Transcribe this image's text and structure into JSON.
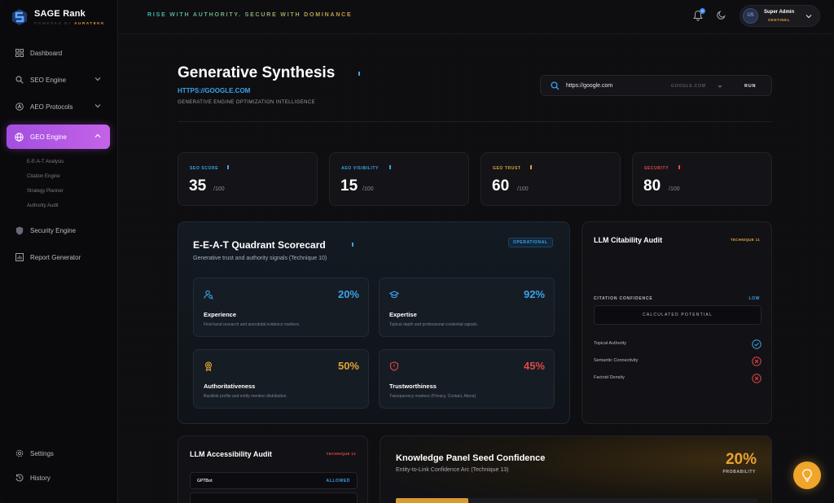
{
  "brand": {
    "name": "SAGE Rank",
    "powered_by": "POWERED BY",
    "vendor": "AURATEKK"
  },
  "sidebar": {
    "items": [
      {
        "label": "Dashboard",
        "icon": "grid-icon"
      },
      {
        "label": "SEO Engine",
        "icon": "search-icon"
      },
      {
        "label": "AEO Protocols",
        "icon": "aeo-icon"
      },
      {
        "label": "GEO Engine",
        "icon": "globe-icon",
        "active": true
      }
    ],
    "geo_subitems": [
      "E-E-A-T Analysis",
      "Citation Engine",
      "Strategy Planner",
      "Authority Audit"
    ],
    "security": "Security Engine",
    "report": "Report Generator",
    "settings": "Settings",
    "history": "History"
  },
  "topbar": {
    "tagline": "RISE WITH AUTHORITY. SECURE WITH DOMINANCE",
    "notification_count": "0",
    "user_initials": "US",
    "user_name": "Super Admin",
    "user_role": "SENTINEL"
  },
  "header": {
    "title": "Generative Synthesis",
    "url": "HTTPS://GOOGLE.COM",
    "subtitle": "GENERATIVE ENGINE OPTIMIZATION INTELLIGENCE"
  },
  "search": {
    "value": "https://google.com",
    "engine": "GOOGLE.COM",
    "run_label": "RUN"
  },
  "stats": [
    {
      "label": "SEO SCORE",
      "value": "35",
      "max": "/100",
      "color": "#3aa3e8"
    },
    {
      "label": "AEO VISIBILITY",
      "value": "15",
      "max": "/100",
      "color": "#3aa3e8"
    },
    {
      "label": "GEO TRUST",
      "value": "60",
      "max": "/100",
      "color": "#e0a435"
    },
    {
      "label": "SECURITY",
      "value": "80",
      "max": "/100",
      "color": "#e04848"
    }
  ],
  "eeat": {
    "title": "E-E-A-T Quadrant Scorecard",
    "description": "Generative trust and authority signals (Technique 10)",
    "status": "OPERATIONAL",
    "quadrants": [
      {
        "title": "Experience",
        "value": "20%",
        "desc": "First-hand research and anecdotal evidence markers.",
        "color": "#3aa3e8",
        "icon": "user-search-icon"
      },
      {
        "title": "Expertise",
        "value": "92%",
        "desc": "Topical depth and professional credential signals.",
        "color": "#3aa3e8",
        "icon": "graduation-cap-icon"
      },
      {
        "title": "Authoritativeness",
        "value": "50%",
        "desc": "Backlink profile and entity mention distribution.",
        "color": "#e0a435",
        "icon": "award-icon"
      },
      {
        "title": "Trustworthiness",
        "value": "45%",
        "desc": "Transparency markers (Privacy, Contact, About).",
        "color": "#e04848",
        "icon": "shield-alert-icon"
      }
    ]
  },
  "citability": {
    "title": "LLM Citability Audit",
    "technique": "TECHNIQUE 11",
    "confidence_label": "CITATION CONFIDENCE",
    "confidence_value": "LOW",
    "calculated": "CALCULATED POTENTIAL",
    "criteria": [
      {
        "label": "Topical Authority",
        "status": "pass"
      },
      {
        "label": "Semantic Connectivity",
        "status": "fail"
      },
      {
        "label": "Factoid Density",
        "status": "fail"
      }
    ]
  },
  "accessibility": {
    "title": "LLM Accessibility Audit",
    "technique": "TECHNIQUE 12",
    "bots": [
      {
        "name": "GPTBot",
        "status": "ALLOWED"
      }
    ]
  },
  "knowledge_panel": {
    "title": "Knowledge Panel Seed Confidence",
    "description": "Entity-to-Link Confidence Arc (Technique 13)",
    "value": "20%",
    "value_label": "PROBABILITY",
    "fraction": 0.2
  }
}
